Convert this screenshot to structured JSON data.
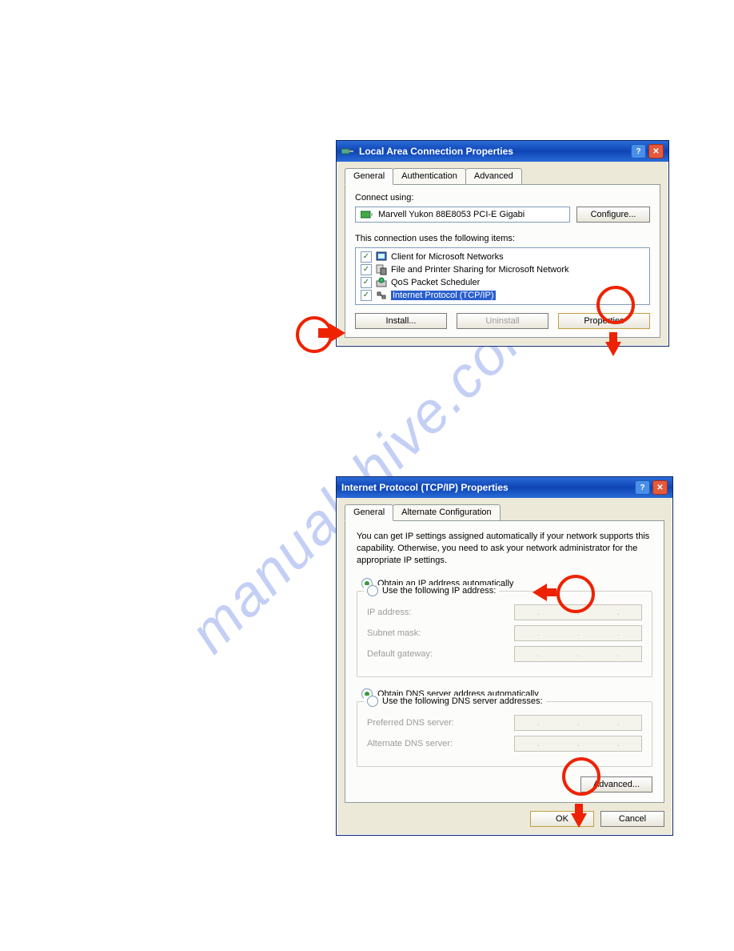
{
  "watermark": "manualshive.com",
  "window1": {
    "title": "Local Area Connection Properties",
    "tabs": [
      "General",
      "Authentication",
      "Advanced"
    ],
    "connectLabel": "Connect using:",
    "adapter": "Marvell Yukon 88E8053 PCI-E Gigabi",
    "configureBtn": "Configure...",
    "itemsLabel": "This connection uses the following items:",
    "items": [
      {
        "label": "Client for Microsoft Networks"
      },
      {
        "label": "File and Printer Sharing for Microsoft Network"
      },
      {
        "label": "QoS Packet Scheduler"
      },
      {
        "label": "Internet Protocol (TCP/IP)"
      }
    ],
    "installBtn": "Install...",
    "uninstallBtn": "Uninstall",
    "propertiesBtn": "Properties"
  },
  "window2": {
    "title": "Internet Protocol (TCP/IP) Properties",
    "tabs": [
      "General",
      "Alternate Configuration"
    ],
    "intro": "You can get IP settings assigned automatically if your network supports this capability. Otherwise, you need to ask your network administrator for the appropriate IP settings.",
    "obtainIp": "Obtain an IP address automatically",
    "useIp": "Use the following IP address:",
    "ipAddress": "IP address:",
    "subnet": "Subnet mask:",
    "gateway": "Default gateway:",
    "obtainDns": "Obtain DNS server address automatically",
    "useDns": "Use the following DNS server addresses:",
    "prefDns": "Preferred DNS server:",
    "altDns": "Alternate DNS server:",
    "advancedBtn": "Advanced...",
    "okBtn": "OK",
    "cancelBtn": "Cancel"
  }
}
